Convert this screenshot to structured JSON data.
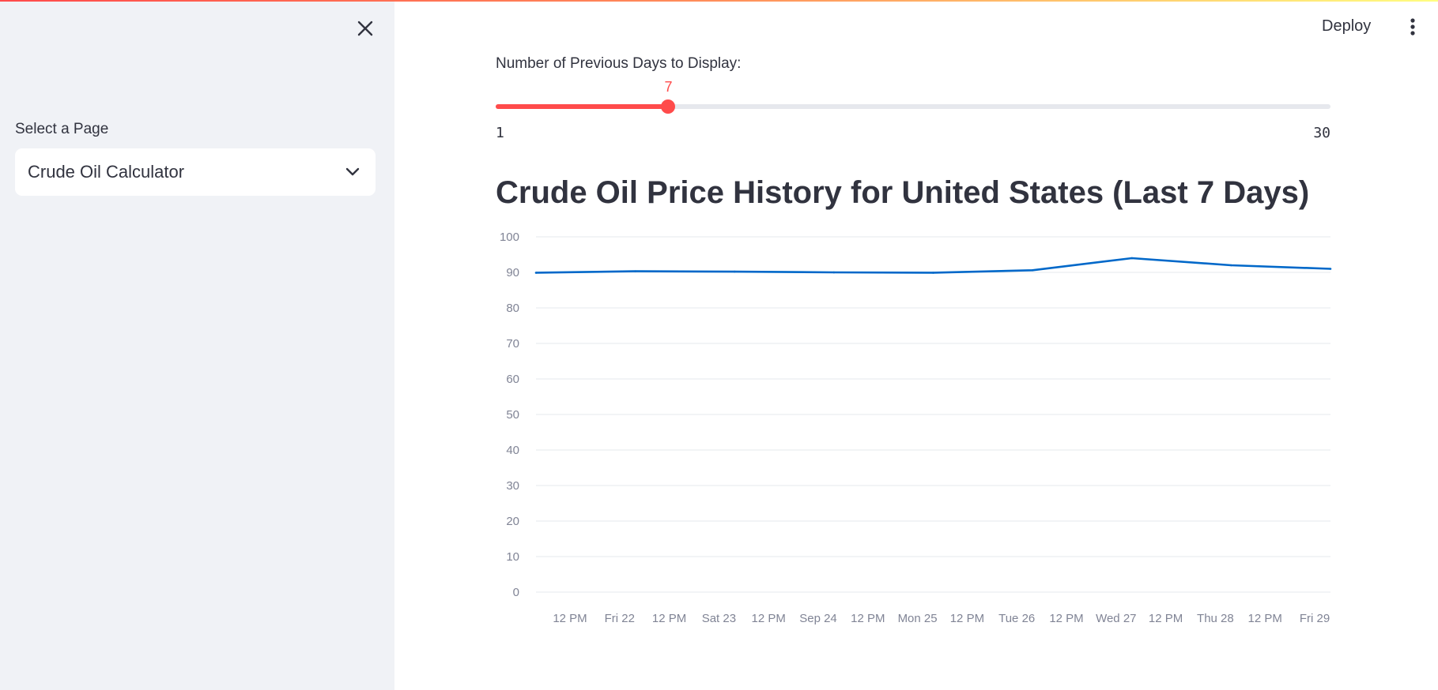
{
  "sidebar": {
    "close_icon": "close-icon",
    "select_label": "Select a Page",
    "selected_page": "Crude Oil Calculator",
    "chevron_icon": "chevron-down-icon"
  },
  "header": {
    "deploy_label": "Deploy",
    "menu_icon": "vertical-ellipsis-icon"
  },
  "slider": {
    "label": "Number of Previous Days to Display:",
    "value": "7",
    "min": "1",
    "max": "30"
  },
  "colors": {
    "accent": "#ff4b4b",
    "line": "#0068c9",
    "sidebar_bg": "#f0f2f6",
    "text": "#31333f"
  },
  "chart_data": {
    "type": "line",
    "title": "Crude Oil Price History for United States (Last 7 Days)",
    "xlabel": "",
    "ylabel": "",
    "ylim": [
      0,
      100
    ],
    "y_ticks": [
      "100",
      "90",
      "80",
      "70",
      "60",
      "50",
      "40",
      "30",
      "20",
      "10",
      "0"
    ],
    "x_tick_labels": [
      "12 PM",
      "Fri 22",
      "12 PM",
      "Sat 23",
      "12 PM",
      "Sep 24",
      "12 PM",
      "Mon 25",
      "12 PM",
      "Tue 26",
      "12 PM",
      "Wed 27",
      "12 PM",
      "Thu 28",
      "12 PM",
      "Fri 29"
    ],
    "grid": true,
    "series": [
      {
        "x": [
          "Sep 21 12 AM",
          "Sep 22 12 AM",
          "Sep 23 12 AM",
          "Sep 24 12 AM",
          "Sep 25 12 AM",
          "Sep 26 12 AM",
          "Sep 27 12 AM",
          "Sep 28 12 AM",
          "Sep 29 12 AM"
        ],
        "values": [
          89.9,
          90.3,
          90.2,
          90.0,
          89.9,
          90.6,
          94.0,
          92.0,
          91.0
        ]
      }
    ]
  }
}
